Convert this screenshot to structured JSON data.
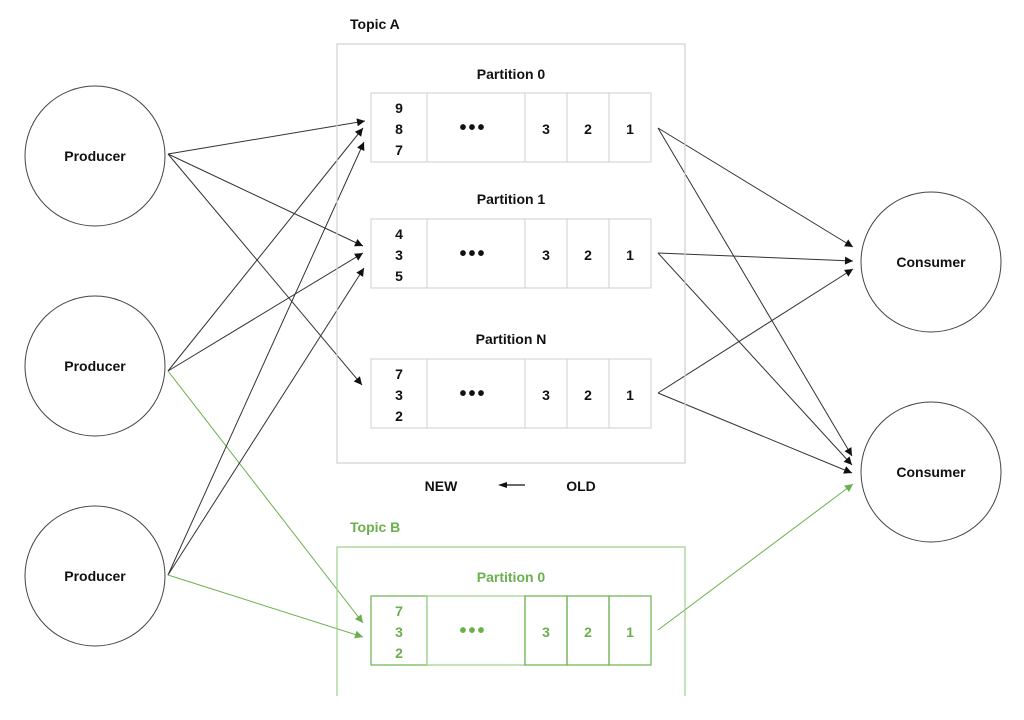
{
  "colors": {
    "ink": "#111111",
    "line": "#333333",
    "box_border": "#d0d0d0",
    "green": "#6ab04c",
    "green_light": "#9dd08a"
  },
  "producers": [
    {
      "label": "Producer"
    },
    {
      "label": "Producer"
    },
    {
      "label": "Producer"
    }
  ],
  "consumers": [
    {
      "label": "Consumer"
    },
    {
      "label": "Consumer"
    }
  ],
  "topic_a": {
    "title": "Topic A",
    "partitions": [
      {
        "title": "Partition 0",
        "new_messages": [
          "9",
          "8",
          "7"
        ],
        "ellipsis": "•••",
        "old_messages": [
          "3",
          "2",
          "1"
        ]
      },
      {
        "title": "Partition 1",
        "new_messages": [
          "4",
          "3",
          "5"
        ],
        "ellipsis": "•••",
        "old_messages": [
          "3",
          "2",
          "1"
        ]
      },
      {
        "title": "Partition N",
        "new_messages": [
          "7",
          "3",
          "2"
        ],
        "ellipsis": "•••",
        "old_messages": [
          "3",
          "2",
          "1"
        ]
      }
    ]
  },
  "order_legend": {
    "new_label": "NEW",
    "arrow": "left-arrow",
    "old_label": "OLD"
  },
  "topic_b": {
    "title": "Topic B",
    "partitions": [
      {
        "title": "Partition 0",
        "new_messages": [
          "7",
          "3",
          "2"
        ],
        "ellipsis": "•••",
        "old_messages": [
          "3",
          "2",
          "1"
        ]
      }
    ]
  },
  "edges": [
    {
      "from": "producer-0",
      "to": "topic-a-partition-0",
      "color": "ink"
    },
    {
      "from": "producer-0",
      "to": "topic-a-partition-1",
      "color": "ink"
    },
    {
      "from": "producer-0",
      "to": "topic-a-partition-n",
      "color": "ink"
    },
    {
      "from": "producer-1",
      "to": "topic-a-partition-0",
      "color": "ink"
    },
    {
      "from": "producer-1",
      "to": "topic-a-partition-1",
      "color": "ink"
    },
    {
      "from": "producer-1",
      "to": "topic-b-partition-0",
      "color": "green"
    },
    {
      "from": "producer-2",
      "to": "topic-a-partition-0",
      "color": "ink"
    },
    {
      "from": "producer-2",
      "to": "topic-a-partition-1",
      "color": "ink"
    },
    {
      "from": "producer-2",
      "to": "topic-b-partition-0",
      "color": "green"
    },
    {
      "from": "topic-a-partition-0",
      "to": "consumer-0",
      "color": "ink"
    },
    {
      "from": "topic-a-partition-0",
      "to": "consumer-1",
      "color": "ink"
    },
    {
      "from": "topic-a-partition-1",
      "to": "consumer-0",
      "color": "ink"
    },
    {
      "from": "topic-a-partition-1",
      "to": "consumer-1",
      "color": "ink"
    },
    {
      "from": "topic-a-partition-n",
      "to": "consumer-0",
      "color": "ink"
    },
    {
      "from": "topic-a-partition-n",
      "to": "consumer-1",
      "color": "ink"
    },
    {
      "from": "topic-b-partition-0",
      "to": "consumer-1",
      "color": "green"
    }
  ]
}
